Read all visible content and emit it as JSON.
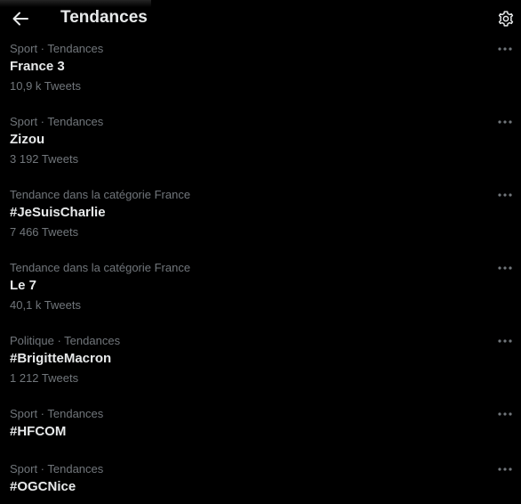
{
  "header": {
    "title": "Tendances",
    "back_icon": "arrow-left-icon",
    "settings_icon": "gear-icon"
  },
  "colors": {
    "background": "#000000",
    "primary_text": "#e7e9ea",
    "secondary_text": "#71767b"
  },
  "trends": [
    {
      "context": "Sport · Tendances",
      "name": "France 3",
      "count": "10,9 k Tweets"
    },
    {
      "context": "Sport · Tendances",
      "name": "Zizou",
      "count": "3 192 Tweets"
    },
    {
      "context": "Tendance dans la catégorie France",
      "name": "#JeSuisCharlie",
      "count": "7 466 Tweets"
    },
    {
      "context": "Tendance dans la catégorie France",
      "name": "Le 7",
      "count": "40,1 k Tweets"
    },
    {
      "context": "Politique · Tendances",
      "name": "#BrigitteMacron",
      "count": "1 212 Tweets"
    },
    {
      "context": "Sport · Tendances",
      "name": "#HFCOM",
      "count": ""
    },
    {
      "context": "Sport · Tendances",
      "name": "#OGCNice",
      "count": ""
    }
  ]
}
